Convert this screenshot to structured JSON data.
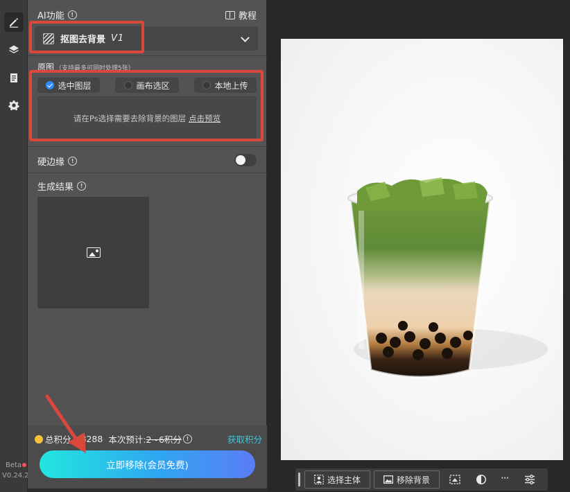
{
  "sidebar": {
    "icons": [
      "pen-icon",
      "layers-icon",
      "clipboard-icon",
      "gear-icon"
    ],
    "beta_label": "Beta",
    "version": "V0.24.2"
  },
  "panel": {
    "ai_title": "AI功能",
    "tutorial_label": "教程",
    "function_select": {
      "selected": "抠图去背景",
      "version": "V1"
    },
    "source": {
      "title": "原图",
      "note": "（支持最多可同时处理5张）",
      "tabs": [
        {
          "label": "选中图层",
          "checked": true
        },
        {
          "label": "画布选区",
          "checked": false
        },
        {
          "label": "本地上传",
          "checked": false
        }
      ],
      "hint": "请在Ps选择需要去除背景的图层",
      "hint_link": "点击预览"
    },
    "hard_edge": {
      "label": "硬边缘",
      "enabled": false
    },
    "result": {
      "title": "生成结果"
    },
    "footer": {
      "points_label": "总积分",
      "points_value": "8288",
      "estimate_label": "本次预计:",
      "estimate_value": "2~6积分",
      "get_points": "获取积分",
      "main_button": "立即移除(会员免费)"
    }
  },
  "canvas_toolbar": {
    "select_subject": "选择主体",
    "remove_background": "移除背景",
    "more": "···"
  },
  "colors": {
    "annotation": "#d9483b",
    "accent_cyan": "#22e6e0",
    "accent_blue": "#5b7cf5",
    "link_cyan": "#3ec7d8"
  }
}
